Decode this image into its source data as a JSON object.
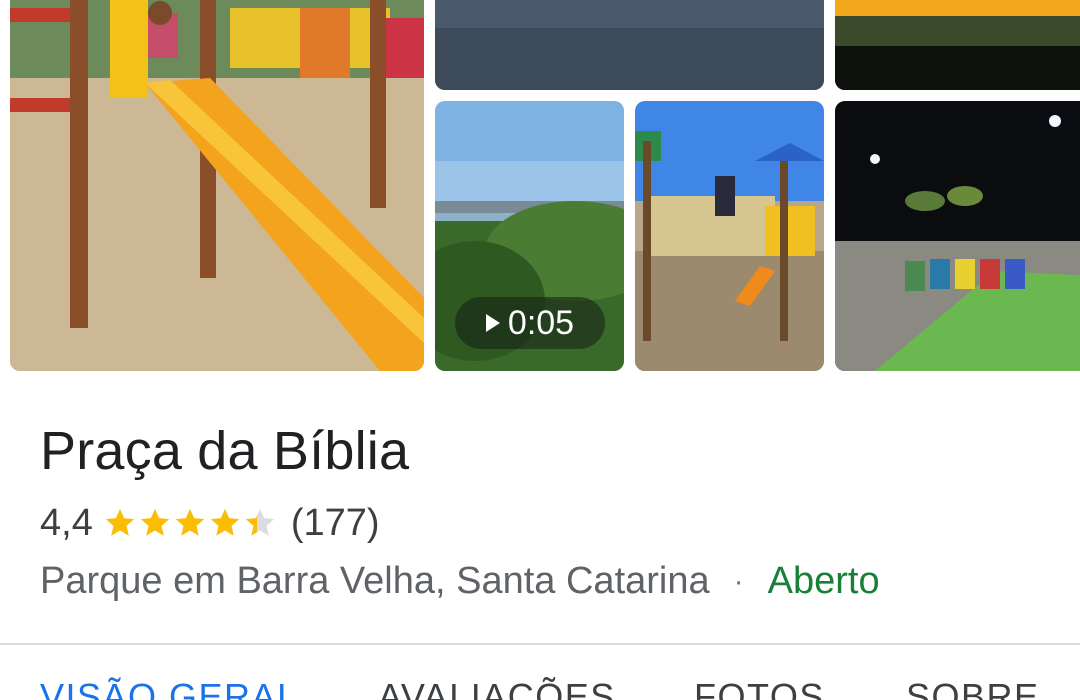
{
  "place": {
    "name": "Praça da Bíblia",
    "rating": "4,4",
    "rating_value": 4.4,
    "review_count": "(177)",
    "category_location": "Parque em Barra Velha, Santa Catarina",
    "separator": "·",
    "status": "Aberto"
  },
  "video": {
    "duration": "0:05"
  },
  "tabs": [
    {
      "label": "VISÃO GERAL",
      "active": true
    },
    {
      "label": "AVALIAÇÕES",
      "active": false
    },
    {
      "label": "FOTOS",
      "active": false
    },
    {
      "label": "SOBRE",
      "active": false
    }
  ],
  "colors": {
    "star": "#fbbc04",
    "star_empty": "#dadce0",
    "open_status": "#188038",
    "active_tab": "#1a73e8"
  }
}
